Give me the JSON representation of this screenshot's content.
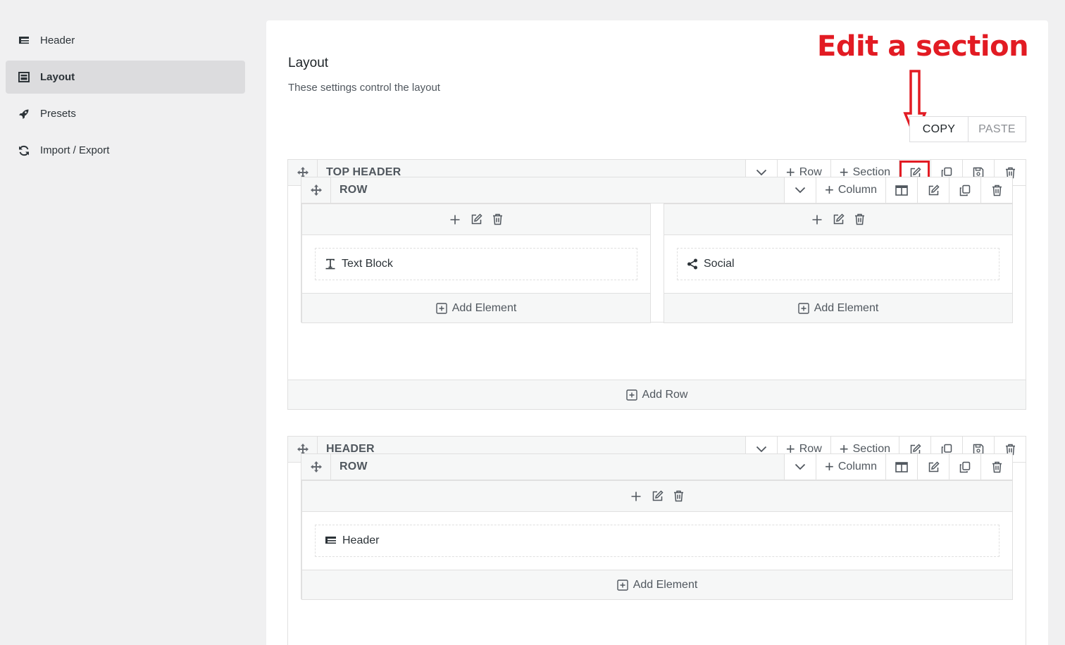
{
  "sidebar": {
    "items": [
      {
        "label": "Header",
        "icon": "header-icon",
        "active": false
      },
      {
        "label": "Layout",
        "icon": "layout-icon",
        "active": true
      },
      {
        "label": "Presets",
        "icon": "rocket-icon",
        "active": false
      },
      {
        "label": "Import / Export",
        "icon": "sync-icon",
        "active": false
      }
    ]
  },
  "main": {
    "title": "Layout",
    "subtitle": "These settings control the layout",
    "copy_label": "COPY",
    "paste_label": "PASTE"
  },
  "annotation": {
    "text": "Edit a section",
    "color": "#e21b23"
  },
  "labels": {
    "row_button": "Row",
    "section_button": "Section",
    "column_button": "Column",
    "add_element": "Add Element",
    "add_row": "Add Row",
    "row_title": "ROW"
  },
  "sections": [
    {
      "title": "TOP HEADER",
      "columns": [
        {
          "element": "Text Block",
          "icon": "text-block-icon"
        },
        {
          "element": "Social",
          "icon": "share-icon"
        }
      ]
    },
    {
      "title": "HEADER",
      "columns": [
        {
          "element": "Header",
          "icon": "header-icon"
        }
      ]
    }
  ]
}
